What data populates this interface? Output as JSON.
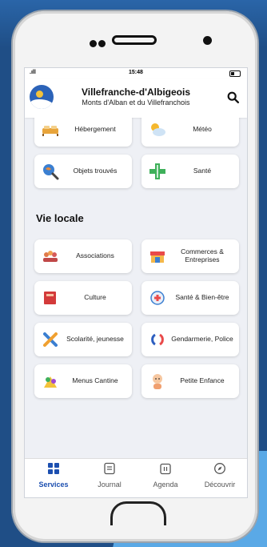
{
  "status": {
    "time": "15:48",
    "signal": ".ıll"
  },
  "header": {
    "title": "Villefranche-d'Albigeois",
    "subtitle": "Monts d'Alban et du Villefranchois",
    "search_icon": "search-icon"
  },
  "top_services": [
    {
      "label": "Hébergement",
      "icon": "bed-icon"
    },
    {
      "label": "Météo",
      "icon": "weather-icon"
    },
    {
      "label": "Objets trouvés",
      "icon": "magnifier-globe-icon"
    },
    {
      "label": "Santé",
      "icon": "medical-cross-icon"
    }
  ],
  "vie_locale": {
    "title": "Vie locale",
    "items": [
      {
        "label": "Associations",
        "icon": "people-icon"
      },
      {
        "label": "Commerces & Entreprises",
        "icon": "shop-icon"
      },
      {
        "label": "Culture",
        "icon": "book-icon"
      },
      {
        "label": "Santé & Bien-être",
        "icon": "health-shield-icon"
      },
      {
        "label": "Scolarité, jeunesse",
        "icon": "pencil-icon"
      },
      {
        "label": "Gendarmerie, Police",
        "icon": "police-icon"
      },
      {
        "label": "Menus Cantine",
        "icon": "food-icon"
      },
      {
        "label": "Petite Enfance",
        "icon": "baby-icon"
      }
    ]
  },
  "tabs": [
    {
      "label": "Services",
      "icon": "grid-icon",
      "active": true
    },
    {
      "label": "Journal",
      "icon": "journal-icon",
      "active": false
    },
    {
      "label": "Agenda",
      "icon": "calendar-icon",
      "active": false
    },
    {
      "label": "Découvrir",
      "icon": "compass-icon",
      "active": false
    }
  ],
  "colors": {
    "accent": "#1c4fb0",
    "background": "#1f4e86"
  }
}
